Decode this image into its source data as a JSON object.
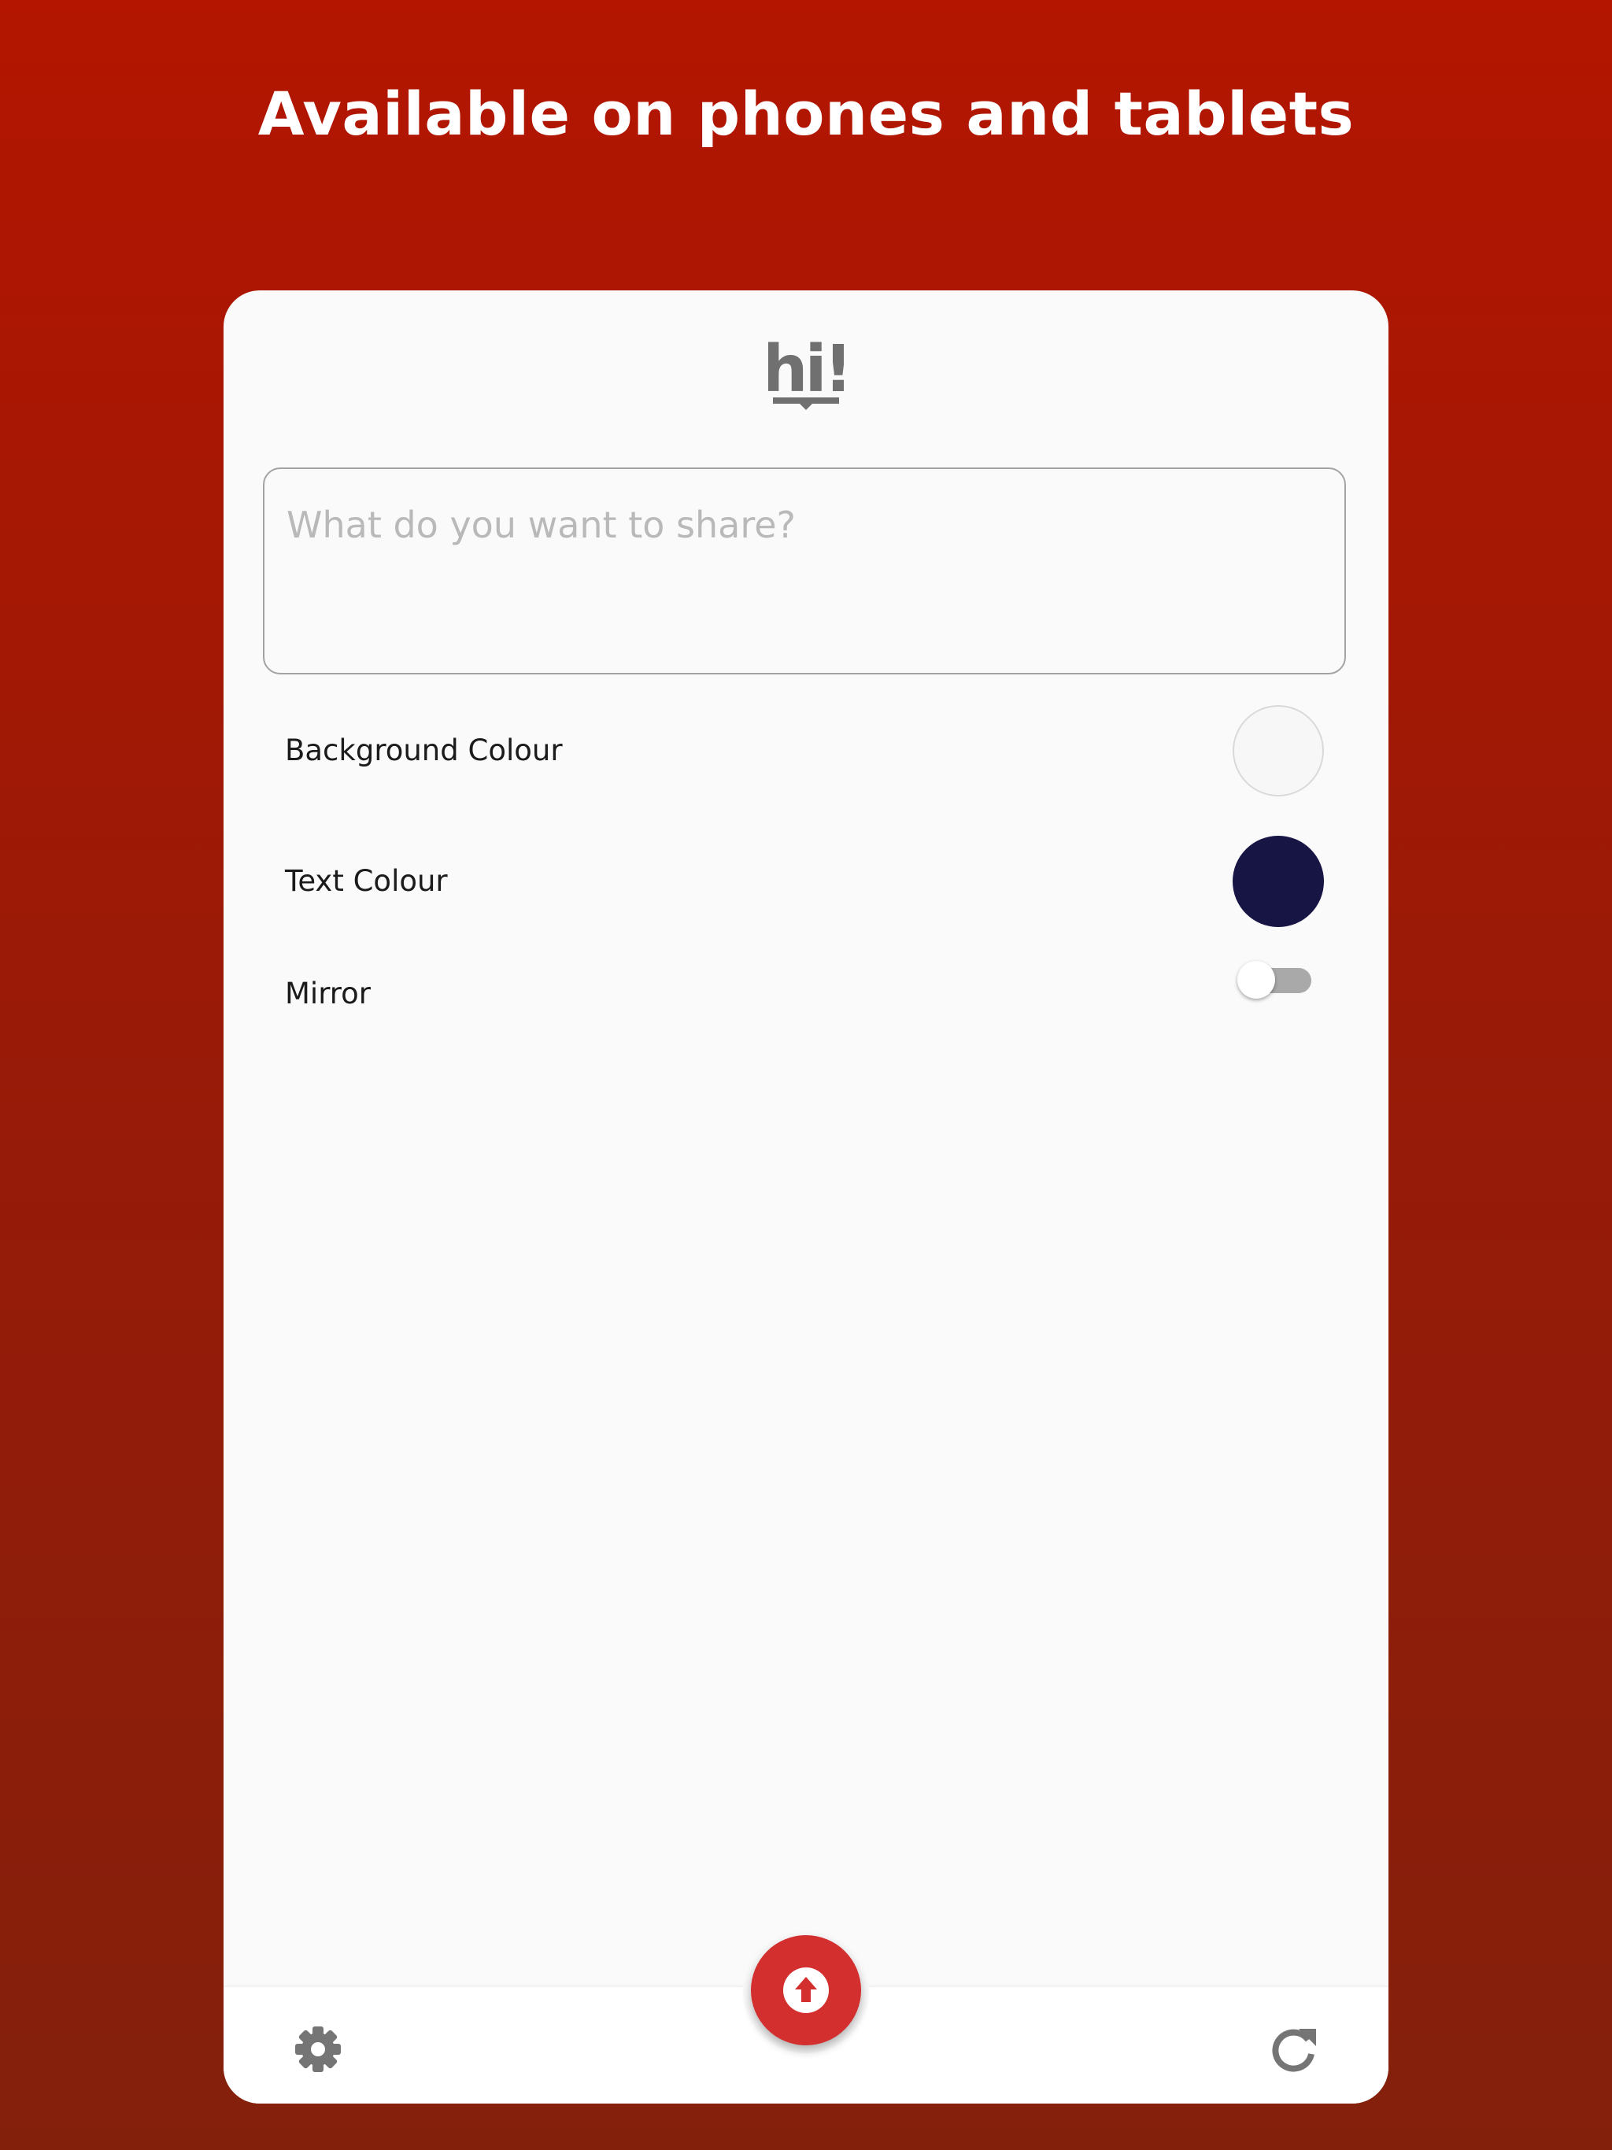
{
  "headline": "Available on phones and tablets",
  "app": {
    "logo_text": "hi!",
    "share_input": {
      "placeholder": "What do you want to share?",
      "value": ""
    },
    "settings": {
      "background_colour": {
        "label": "Background Colour",
        "value": "#f7f7f7"
      },
      "text_colour": {
        "label": "Text Colour",
        "value": "#171543"
      },
      "mirror": {
        "label": "Mirror",
        "enabled": false
      }
    },
    "bottom_bar": {
      "left_icon": "gear-icon",
      "center_icon": "upload-arrow-icon",
      "right_icon": "refresh-icon"
    }
  },
  "colors": {
    "background_top": "#b31500",
    "background_bottom": "#83200c",
    "accent": "#d32f2f",
    "icon_grey": "#757575"
  }
}
